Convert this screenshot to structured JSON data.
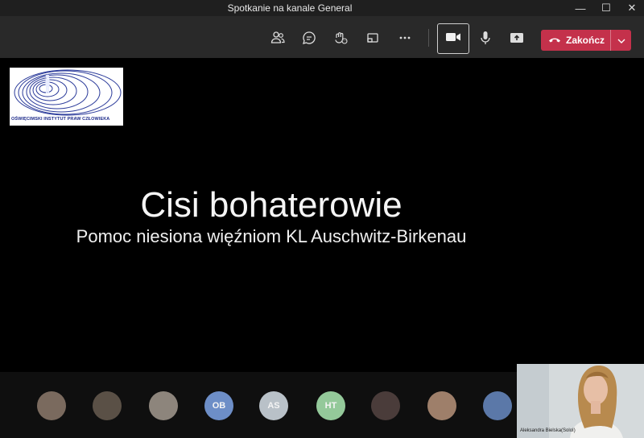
{
  "window": {
    "title": "Spotkanie na kanale General",
    "minimize_glyph": "—",
    "maximize_glyph": "☐",
    "close_glyph": "✕"
  },
  "toolbar": {
    "icons": [
      "participants-icon",
      "chat-icon",
      "reactions-icon",
      "share-tray-icon",
      "more-options-icon",
      "camera-icon",
      "microphone-icon",
      "share-content-icon"
    ],
    "end_call": {
      "label": "Zakończ",
      "color": "#c4314b"
    }
  },
  "slide": {
    "title": "Cisi bohaterowie",
    "subtitle": "Pomoc niesiona więźniom KL Auschwitz-Birkenau",
    "logo_text": "OŚWIĘCIMSKI INSTYTUT PRAW CZŁOWIEKA",
    "logo_color": "#1c2a8a"
  },
  "participants": [
    {
      "initials": "",
      "color": "#7a6a5e"
    },
    {
      "initials": "",
      "color": "#5a5046"
    },
    {
      "initials": "",
      "color": "#8d857c"
    },
    {
      "initials": "OB",
      "color": "#6d8ec7"
    },
    {
      "initials": "AS",
      "color": "#b9c1c8"
    },
    {
      "initials": "HT",
      "color": "#94c99a"
    },
    {
      "initials": "",
      "color": "#4a3c3a"
    },
    {
      "initials": "",
      "color": "#9e7f6a"
    },
    {
      "initials": "",
      "color": "#5b78a8"
    }
  ],
  "self_view": {
    "name": "Aleksandra Bielska(SoloI)"
  }
}
